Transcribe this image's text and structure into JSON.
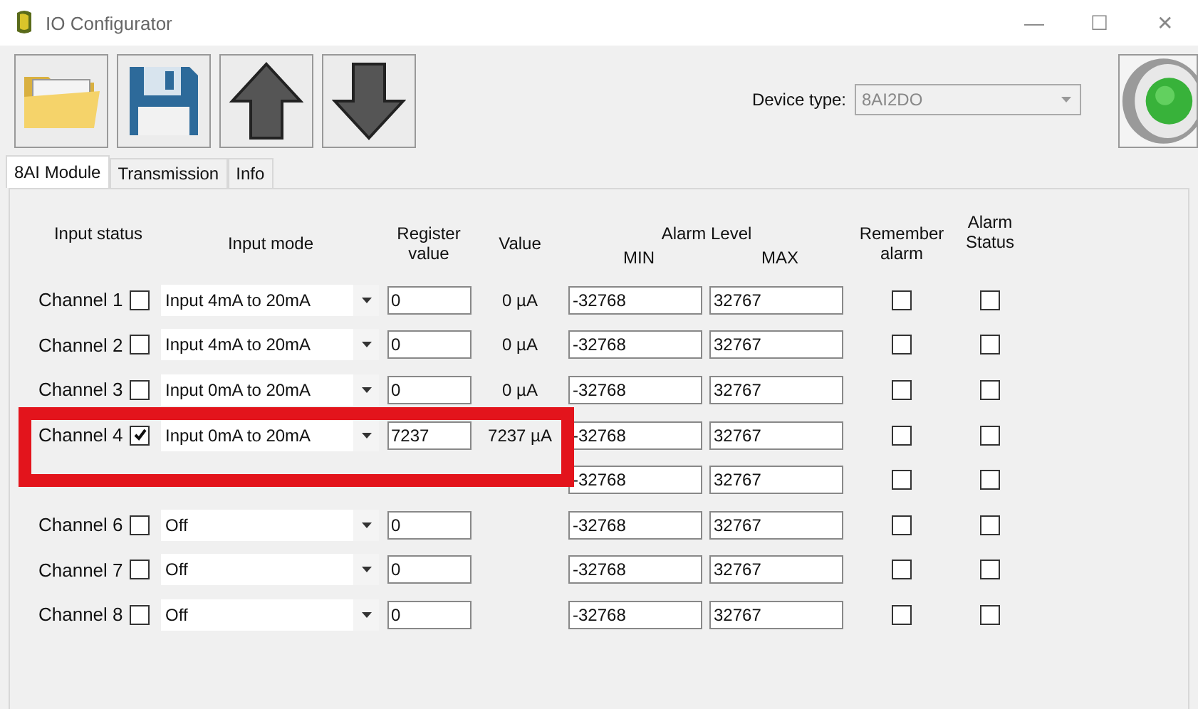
{
  "window": {
    "title": "IO Configurator",
    "controls": [
      "—",
      "☐",
      "✕"
    ]
  },
  "toolbar": [
    {
      "kind": "open"
    },
    {
      "kind": "save"
    },
    {
      "kind": "upload"
    },
    {
      "kind": "download"
    }
  ],
  "device_type": {
    "label": "Device type:",
    "value": "8AI2DO",
    "disabled": true
  },
  "status_light": {
    "on": true
  },
  "tabs": [
    {
      "label": "8AI Module",
      "selected": true
    },
    {
      "label": "Transmission",
      "selected": false
    },
    {
      "label": "Info",
      "selected": false
    }
  ],
  "columns": {
    "input_status": "Input status",
    "input_mode": "Input mode",
    "register_value": "Register value",
    "value": "Value",
    "alarm_level": "Alarm Level",
    "min": "MIN",
    "max": "MAX",
    "remember_alarm": "Remember alarm",
    "alarm_status": "Alarm Status"
  },
  "channels": [
    {
      "label": "Channel 1",
      "checked": false,
      "mode": "Input 4mA to 20mA",
      "register": "0",
      "value": "0 µA",
      "min": "-32768",
      "max": "32767",
      "remember_alarm": false,
      "alarm_status": false
    },
    {
      "label": "Channel 2",
      "checked": false,
      "mode": "Input 4mA to 20mA",
      "register": "0",
      "value": "0 µA",
      "min": "-32768",
      "max": "32767",
      "remember_alarm": false,
      "alarm_status": false
    },
    {
      "label": "Channel 3",
      "checked": false,
      "mode": "Input 0mA to 20mA",
      "register": "0",
      "value": "0 µA",
      "min": "-32768",
      "max": "32767",
      "remember_alarm": false,
      "alarm_status": false
    },
    {
      "label": "Channel 4",
      "checked": true,
      "mode": "Input 0mA to 20mA",
      "register": "7237",
      "value": "7237 µA",
      "min": "-32768",
      "max": "32767",
      "remember_alarm": false,
      "alarm_status": false,
      "highlighted": true
    },
    {
      "min": "-32768",
      "max": "32767",
      "remember_alarm": false,
      "alarm_status": false
    },
    {
      "label": "Channel 6",
      "checked": false,
      "mode": "Off",
      "register": "0",
      "min": "-32768",
      "max": "32767",
      "remember_alarm": false,
      "alarm_status": false
    },
    {
      "label": "Channel 7",
      "checked": false,
      "mode": "Off",
      "register": "0",
      "min": "-32768",
      "max": "32767",
      "remember_alarm": false,
      "alarm_status": false
    },
    {
      "label": "Channel 8",
      "checked": false,
      "mode": "Off",
      "register": "0",
      "min": "-32768",
      "max": "32767",
      "remember_alarm": false,
      "alarm_status": false
    }
  ]
}
